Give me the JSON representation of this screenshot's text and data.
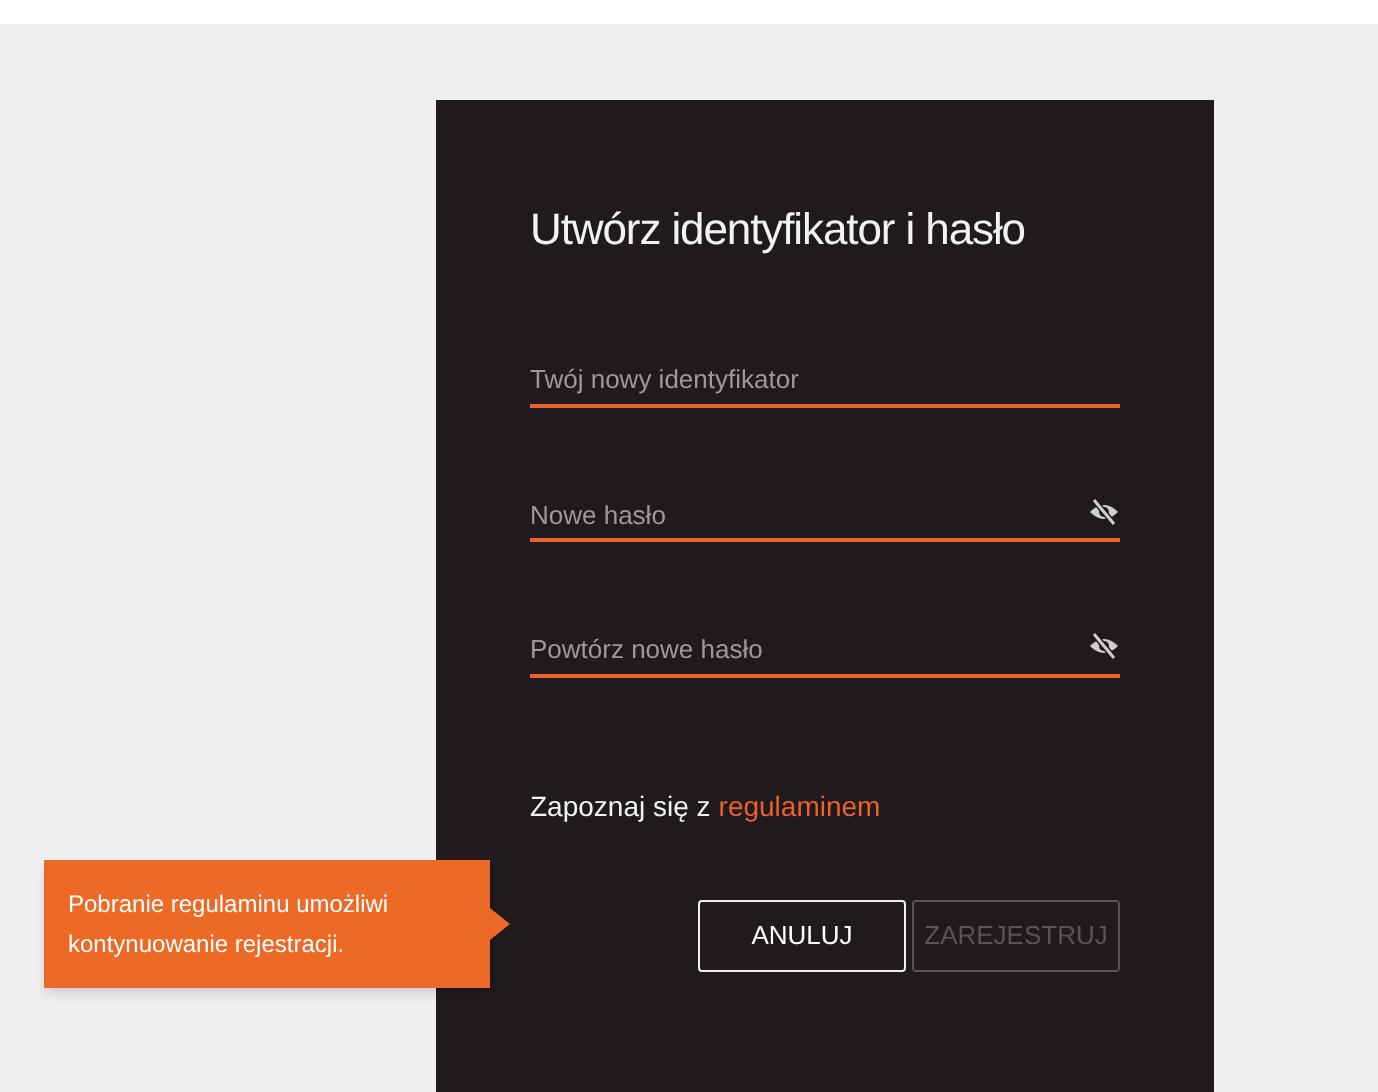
{
  "title": "Utwórz identyfikator i hasło",
  "fields": [
    {
      "placeholder": "Twój nowy identyfikator",
      "kind": "text"
    },
    {
      "placeholder": "Nowe hasło",
      "kind": "password"
    },
    {
      "placeholder": "Powtórz nowe hasło",
      "kind": "password"
    }
  ],
  "terms": {
    "text": "Zapoznaj się z",
    "link": "regulaminem"
  },
  "tooltip": "Pobranie regulaminu umożliwi kontynuowanie rejestracji.",
  "buttons": [
    {
      "label": "ANULUJ",
      "disabled": false
    },
    {
      "label": "ZAREJESTRUJ",
      "disabled": true
    }
  ]
}
